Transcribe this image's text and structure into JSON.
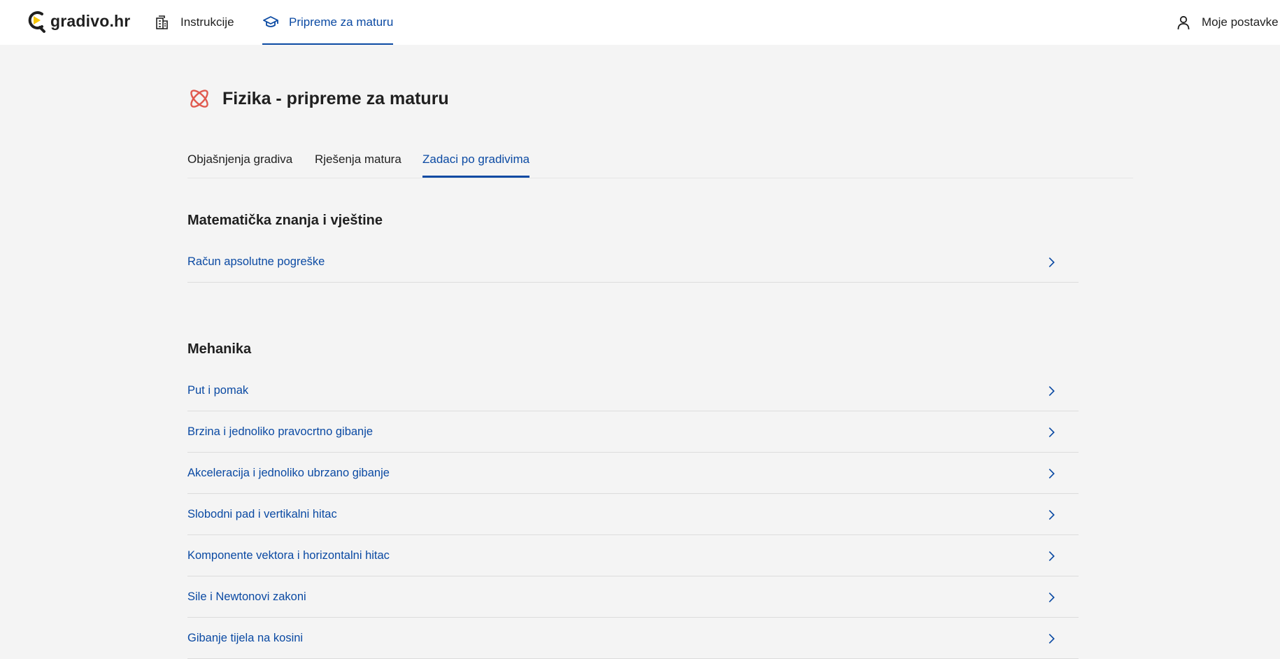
{
  "brand": {
    "name": "gradivo.hr",
    "accent": "#0b4aa3",
    "logo_accent": "#f5c400"
  },
  "nav": {
    "items": [
      {
        "label": "Instrukcije",
        "icon": "building-icon",
        "active": false
      },
      {
        "label": "Pripreme za maturu",
        "icon": "graduation-cap-icon",
        "active": true
      }
    ],
    "user": {
      "label": "Moje postavke",
      "icon": "user-icon"
    }
  },
  "page": {
    "title": "Fizika - pripreme za maturu",
    "icon": "atom-icon",
    "icon_color": "#e05a4f"
  },
  "tabs": [
    {
      "label": "Objašnjenja gradiva",
      "active": false
    },
    {
      "label": "Rješenja matura",
      "active": false
    },
    {
      "label": "Zadaci po gradivima",
      "active": true
    }
  ],
  "sections": [
    {
      "title": "Matematička znanja i vještine",
      "items": [
        {
          "label": "Račun apsolutne pogreške"
        }
      ]
    },
    {
      "title": "Mehanika",
      "items": [
        {
          "label": "Put i pomak"
        },
        {
          "label": "Brzina i jednoliko pravocrtno gibanje"
        },
        {
          "label": "Akceleracija i jednoliko ubrzano gibanje"
        },
        {
          "label": "Slobodni pad i vertikalni hitac"
        },
        {
          "label": "Komponente vektora i horizontalni hitac"
        },
        {
          "label": "Sile i Newtonovi zakoni"
        },
        {
          "label": "Gibanje tijela na kosini"
        }
      ]
    }
  ]
}
